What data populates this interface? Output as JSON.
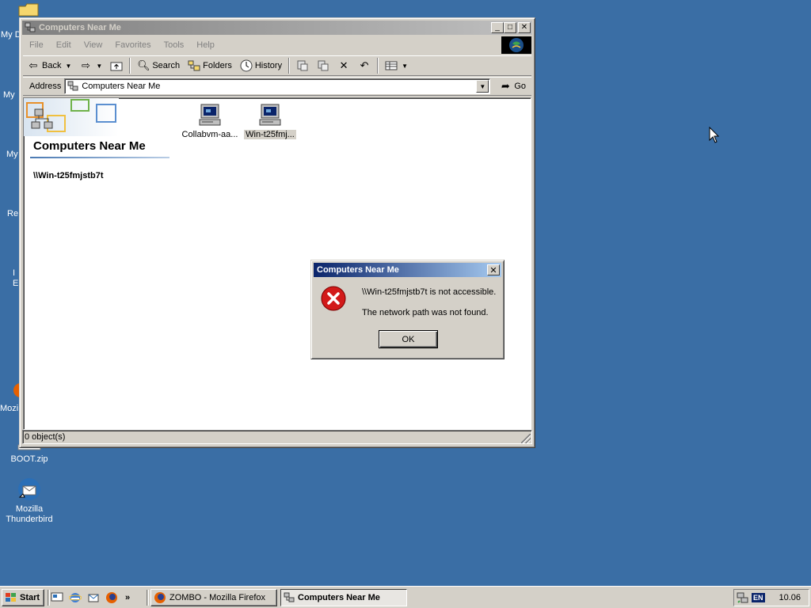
{
  "desktop": {
    "icons": {
      "boot_zip": "BOOT.zip",
      "thunderbird": "Mozilla Thunderbird"
    },
    "clipped_labels": [
      "My D",
      "My",
      "My",
      "Re",
      "I",
      "E",
      "Mozill"
    ]
  },
  "explorer": {
    "title": "Computers Near Me",
    "menu": [
      "File",
      "Edit",
      "View",
      "Favorites",
      "Tools",
      "Help"
    ],
    "toolbar": {
      "back": "Back",
      "search": "Search",
      "folders": "Folders",
      "history": "History"
    },
    "address": {
      "label": "Address",
      "value": "Computers Near Me",
      "go": "Go"
    },
    "folder_title": "Computers Near Me",
    "selected_path": "\\\\Win-t25fmjstb7t",
    "items": [
      {
        "label": "Collabvm-aa...",
        "selected": false
      },
      {
        "label": "Win-t25fmj...",
        "selected": true
      }
    ],
    "status": "0 object(s)"
  },
  "dialog": {
    "title": "Computers Near Me",
    "message_line1": "\\\\Win-t25fmjstb7t is not accessible.",
    "message_line2": "The network path was not found.",
    "ok": "OK",
    "icon": "error-icon"
  },
  "taskbar": {
    "start": "Start",
    "tasks": [
      {
        "label": "ZOMBO - Mozilla Firefox",
        "active": false
      },
      {
        "label": "Computers Near Me",
        "active": true
      }
    ],
    "language": "EN",
    "clock": "10.06"
  },
  "colors": {
    "desktop": "#3a6ea5",
    "active_title_start": "#0a246a",
    "face": "#d4d0c8"
  }
}
